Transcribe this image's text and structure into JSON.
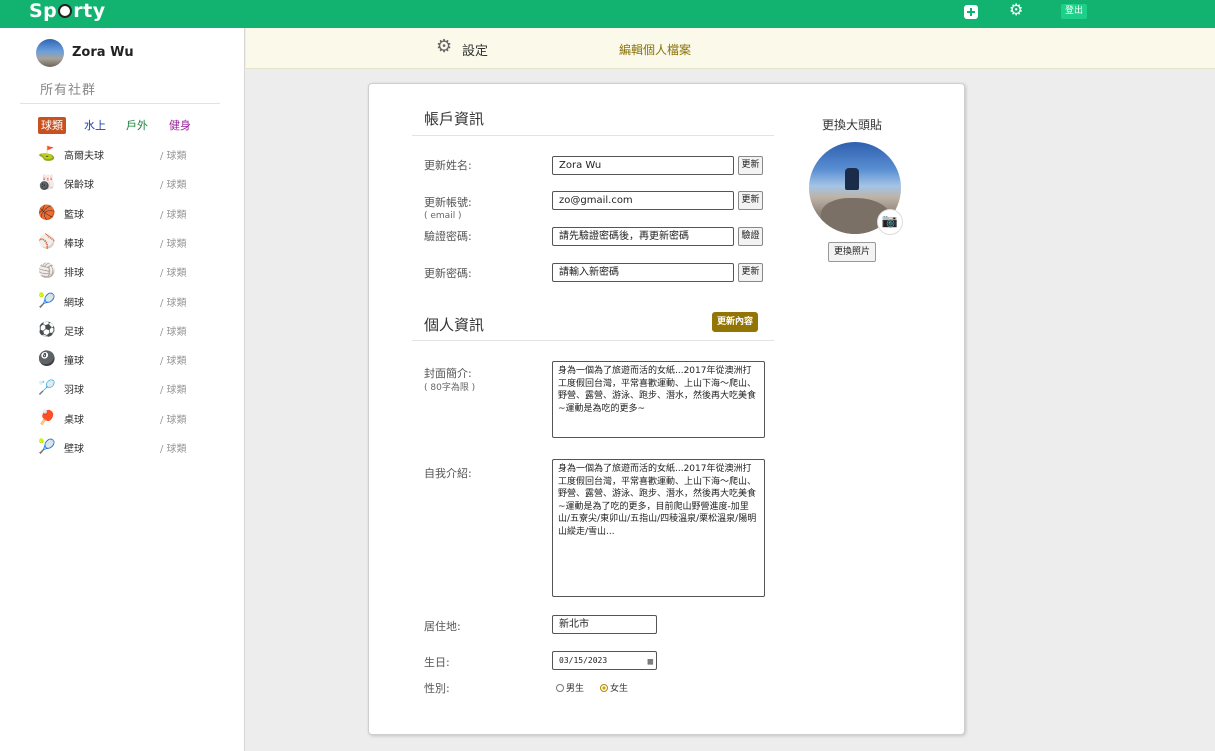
{
  "topbar": {
    "logo_pre": "Sp",
    "logo_post": "rty",
    "logout": "登出",
    "bg_color": "#12b370"
  },
  "user": {
    "name": "Zora Wu"
  },
  "sidebar": {
    "all_groups": "所有社群",
    "categories": [
      {
        "label": "球類",
        "color": "#c8511f"
      },
      {
        "label": "水上",
        "color": "#1e3fb0"
      },
      {
        "label": "戶外",
        "color": "#178036"
      },
      {
        "label": "健身",
        "color": "#9b1ea0"
      }
    ],
    "sports": [
      {
        "icon": "golf-icon",
        "glyph": "⛳",
        "name": "高爾夫球",
        "tag": "/ 球類"
      },
      {
        "icon": "bowling-icon",
        "glyph": "🎳",
        "name": "保齡球",
        "tag": "/ 球類"
      },
      {
        "icon": "basketball-icon",
        "glyph": "🏀",
        "name": "籃球",
        "tag": "/ 球類"
      },
      {
        "icon": "baseball-icon",
        "glyph": "⚾",
        "name": "棒球",
        "tag": "/ 球類"
      },
      {
        "icon": "volleyball-icon",
        "glyph": "🏐",
        "name": "排球",
        "tag": "/ 球類"
      },
      {
        "icon": "tennis-icon",
        "glyph": "🎾",
        "name": "網球",
        "tag": "/ 球類"
      },
      {
        "icon": "soccer-icon",
        "glyph": "⚽",
        "name": "足球",
        "tag": "/ 球類"
      },
      {
        "icon": "billiards-icon",
        "glyph": "🎱",
        "name": "撞球",
        "tag": "/ 球類"
      },
      {
        "icon": "badminton-icon",
        "glyph": "🏸",
        "name": "羽球",
        "tag": "/ 球類"
      },
      {
        "icon": "ping-pong-icon",
        "glyph": "🏓",
        "name": "桌球",
        "tag": "/ 球類"
      },
      {
        "icon": "squash-icon",
        "glyph": "🎾",
        "name": "壁球",
        "tag": "/ 球類"
      }
    ]
  },
  "subnav": {
    "settings": "設定",
    "edit_profile": "編輯個人檔案"
  },
  "account": {
    "title": "帳戶資訊",
    "name_label": "更新姓名:",
    "name_value": "Zora Wu",
    "account_label": "更新帳號:",
    "account_sub": "( email )",
    "account_value": "zo@gmail.com",
    "verify_label": "驗證密碼:",
    "verify_placeholder": "請先驗證密碼後，再更新密碼",
    "password_label": "更新密碼:",
    "password_placeholder": "請輸入新密碼",
    "update_btn": "更新",
    "verify_btn": "驗證"
  },
  "personal": {
    "title": "個人資訊",
    "update_content_btn": "更新內容",
    "cover_label": "封面簡介:",
    "cover_sub": "( 80字為限 )",
    "cover_text": "身為一個為了旅遊而活的女紙...2017年從澳洲打工度假回台灣，平常喜歡運動、上山下海～爬山、野營、露營、游泳、跑步、潛水，然後再大吃美食~運動是為吃的更多~",
    "intro_label": "自我介紹:",
    "intro_text": "身為一個為了旅遊而活的女紙...2017年從澳洲打工度假回台灣，平常喜歡運動、上山下海～爬山、野營、露營、游泳、跑步、潛水，然後再大吃美食~運動是為了吃的更多，目前爬山野營進度-加里山/五寮尖/東卯山/五指山/四稜溫泉/栗松溫泉/陽明山縱走/雪山...",
    "residence_label": "居住地:",
    "residence_value": "新北市",
    "birthday_label": "生日:",
    "birthday_value": "03/15/2023",
    "gender_label": "性別:",
    "gender_male": "男生",
    "gender_female": "女生",
    "gender_selected": "female"
  },
  "photo": {
    "title": "更換大頭貼",
    "change_btn": "更換照片"
  }
}
